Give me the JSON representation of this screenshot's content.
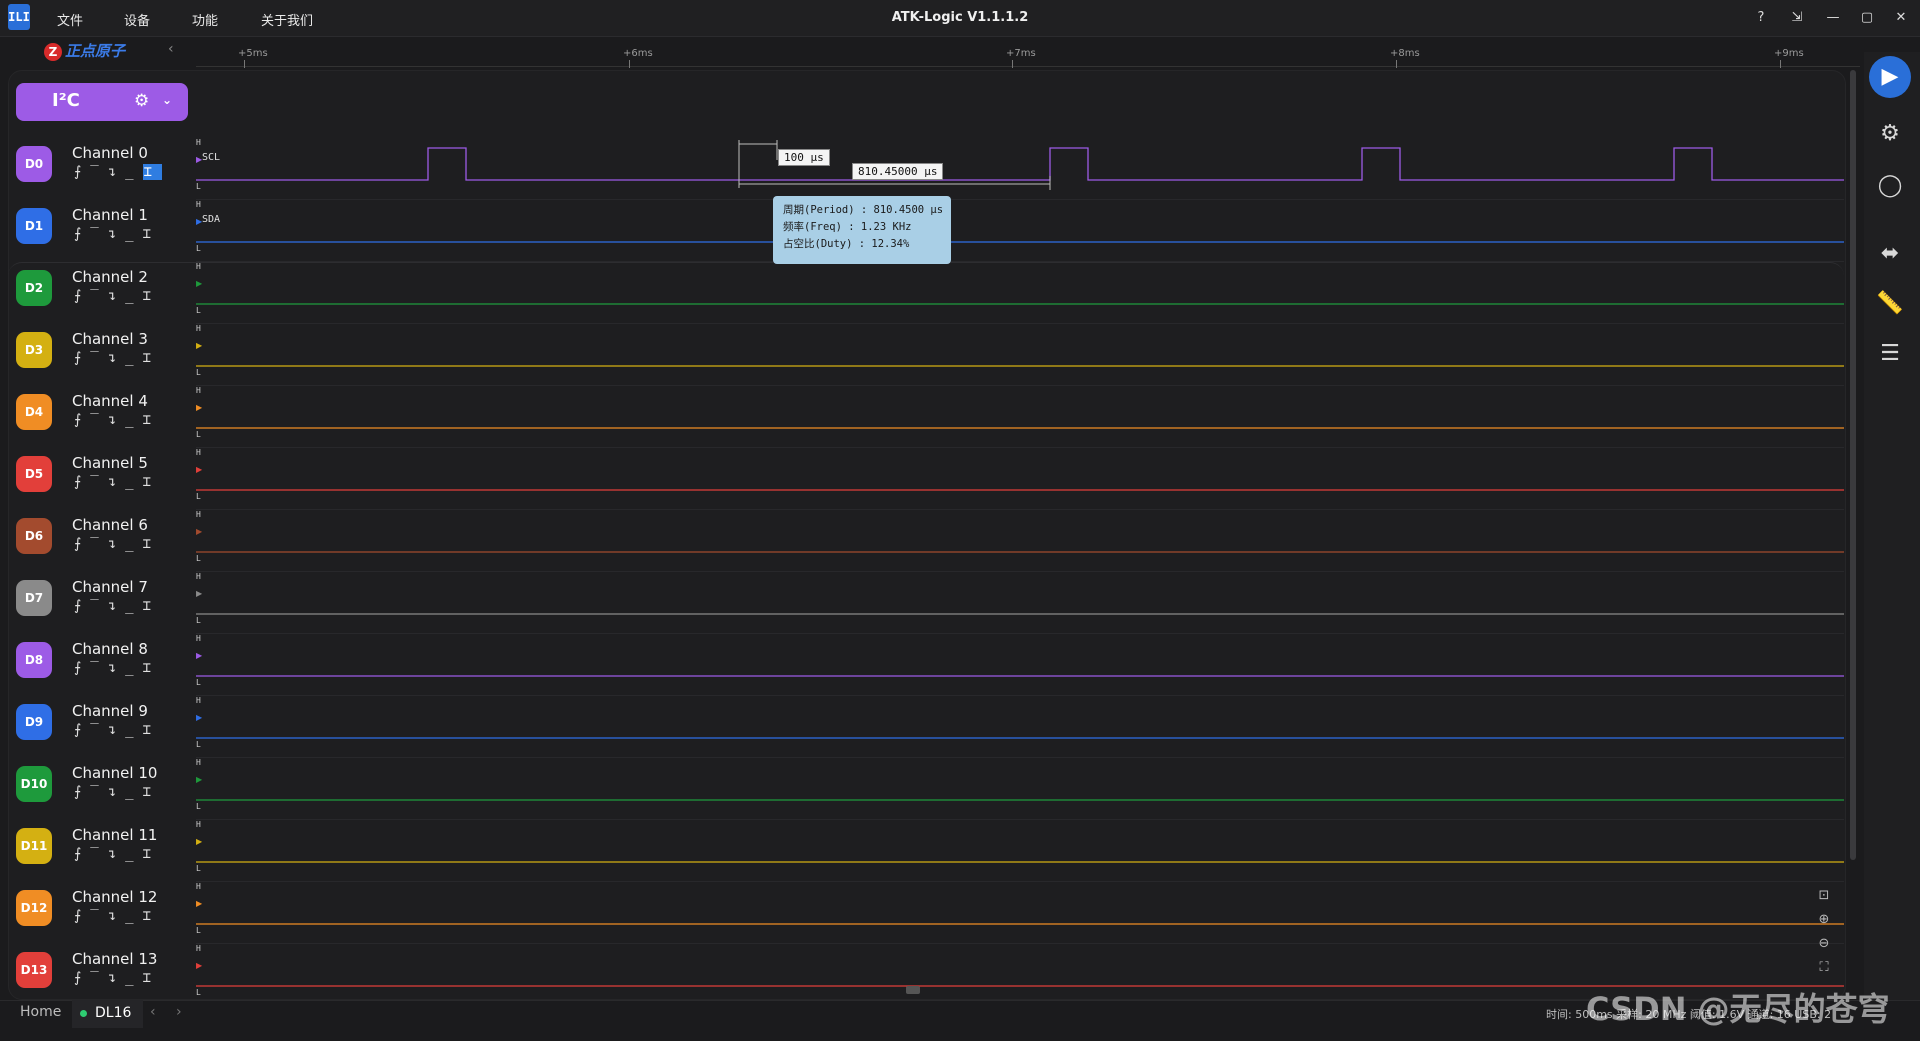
{
  "app": {
    "title": "ATK-Logic V1.1.1.2",
    "icon_text": "ILI",
    "logo_text": "正点原子",
    "logo_mark": "Z"
  },
  "menu": [
    "文件",
    "设备",
    "功能",
    "关于我们"
  ],
  "window_controls": {
    "help": "?",
    "pin": "⇲",
    "minimize": "—",
    "maximize": "▢",
    "close": "✕"
  },
  "time_axis": {
    "ticks": [
      "+5ms",
      "+6ms",
      "+7ms",
      "+8ms",
      "+9ms"
    ]
  },
  "analyzer": {
    "label": "I²C",
    "gear": "⚙",
    "chevron": "⌄"
  },
  "trigger_glyphs": [
    "⨍",
    "‾",
    "↴",
    "_",
    "⌶"
  ],
  "channels": [
    {
      "id": "D0",
      "name": "Channel 0",
      "color": "#9d5be6",
      "signal": "SCL"
    },
    {
      "id": "D1",
      "name": "Channel 1",
      "color": "#2f6ee6",
      "signal": "SDA"
    },
    {
      "id": "D2",
      "name": "Channel 2",
      "color": "#1e9a3c"
    },
    {
      "id": "D3",
      "name": "Channel 3",
      "color": "#d4b012"
    },
    {
      "id": "D4",
      "name": "Channel 4",
      "color": "#f08d24"
    },
    {
      "id": "D5",
      "name": "Channel 5",
      "color": "#e23f3a"
    },
    {
      "id": "D6",
      "name": "Channel 6",
      "color": "#a34b2e"
    },
    {
      "id": "D7",
      "name": "Channel 7",
      "color": "#8a8a8a"
    },
    {
      "id": "D8",
      "name": "Channel 8",
      "color": "#9d5be6"
    },
    {
      "id": "D9",
      "name": "Channel 9",
      "color": "#2f6ee6"
    },
    {
      "id": "D10",
      "name": "Channel 10",
      "color": "#1e9a3c"
    },
    {
      "id": "D11",
      "name": "Channel 11",
      "color": "#d4b012"
    },
    {
      "id": "D12",
      "name": "Channel 12",
      "color": "#f08d24"
    },
    {
      "id": "D13",
      "name": "Channel 13",
      "color": "#e23f3a"
    }
  ],
  "level_labels": {
    "high": "H",
    "low": "L"
  },
  "measurements": {
    "pulse_width": "100 µs",
    "period_span": "810.45000 µs",
    "tooltip": {
      "period": "周期(Period)  : 810.4500 µs",
      "freq": "频率(Freq)    : 1.23 KHz",
      "duty": "占空比(Duty)  : 12.34%"
    }
  },
  "tabs": {
    "home": "Home",
    "device": "DL16",
    "nav": "‹ ›"
  },
  "status": "时间: 500ms  采样: 20 MHz  阈值: 1.6V  通道: 16  USB: 2",
  "watermark": "CSDN @无尽的苍穹"
}
